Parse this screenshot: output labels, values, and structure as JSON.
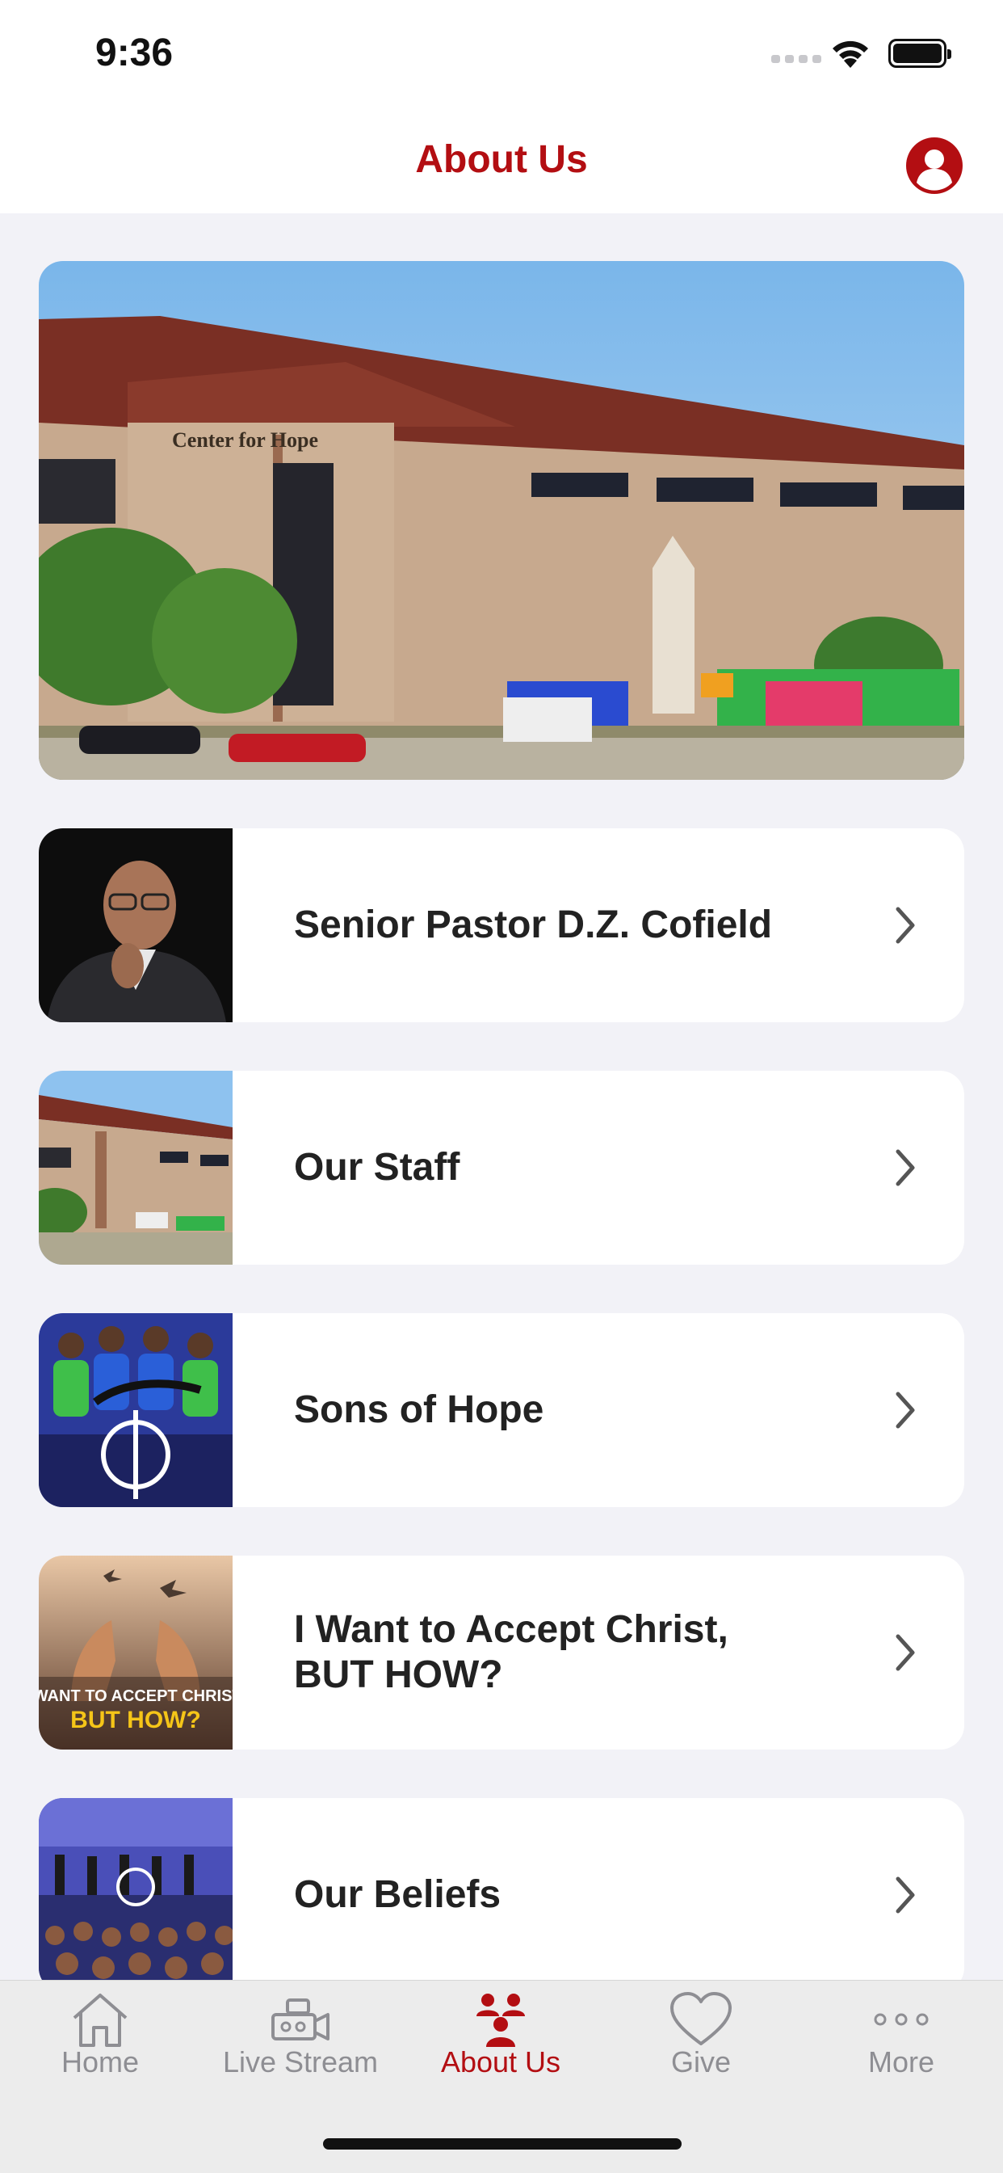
{
  "status_bar": {
    "time": "9:36"
  },
  "header": {
    "title": "About Us",
    "profile_icon": "person-circle-icon"
  },
  "hero": {
    "caption_sign": "Center for Hope"
  },
  "menu": [
    {
      "label": "Senior Pastor D.Z. Cofield",
      "thumb": "pastor"
    },
    {
      "label": "Our Staff",
      "thumb": "building"
    },
    {
      "label": "Sons of Hope",
      "thumb": "group"
    },
    {
      "label": "I Want to Accept Christ,\nBUT HOW?",
      "thumb": "accept",
      "thumb_text_1": "I WANT TO ACCEPT CHRIST!",
      "thumb_text_2": "BUT HOW?"
    },
    {
      "label": "Our Beliefs",
      "thumb": "congregation"
    }
  ],
  "tabs": [
    {
      "label": "Home",
      "icon": "house-icon",
      "active": false
    },
    {
      "label": "Live Stream",
      "icon": "video-camera-icon",
      "active": false
    },
    {
      "label": "About Us",
      "icon": "people-icon",
      "active": true
    },
    {
      "label": "Give",
      "icon": "heart-icon",
      "active": false
    },
    {
      "label": "More",
      "icon": "ellipsis-icon",
      "active": false
    }
  ],
  "colors": {
    "accent": "#b30e12",
    "background": "#f2f2f7",
    "tab_inactive": "#8e8e93"
  }
}
